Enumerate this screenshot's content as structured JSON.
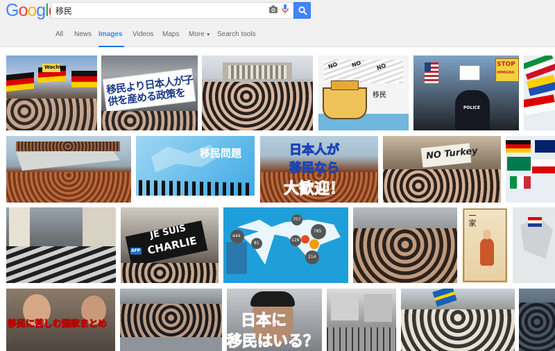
{
  "logo": {
    "letters": [
      "G",
      "o",
      "o",
      "g",
      "l",
      "e"
    ]
  },
  "search": {
    "query": "移民",
    "placeholder": ""
  },
  "tabs": [
    {
      "label": "All"
    },
    {
      "label": "News"
    },
    {
      "label": "Images"
    },
    {
      "label": "Videos"
    },
    {
      "label": "Maps"
    },
    {
      "label": "More"
    },
    {
      "label": "Search tools"
    }
  ],
  "images": {
    "r1c2_sign": "移民より日本人が子供を産める政策を",
    "r1c4_caption": "移民",
    "r1c4_no": "NO",
    "r1c5_police": "POLICE",
    "r1c5_sign": "STOP",
    "r1c5_sign2": "IMMIGRA",
    "r1c1_sign": "Wacht",
    "r2c2_title": "移民問題",
    "r2c3_line1": "日本人が",
    "r2c3_line2": "移民なら",
    "r2c3_line3": "大歓迎！",
    "r2c4_sign": "NO Turkey",
    "r3c2_line1": "JE SUIS",
    "r3c2_line2": "CHARLIE",
    "r3c2_badge": "AFP",
    "r3c3_nums": [
      "707",
      "785",
      "444",
      "81",
      "129",
      "214"
    ],
    "r3c5_text": "一家",
    "r4c1_caption": "移民に苦しむ国家まとめ",
    "r4c3_line1": "日本に",
    "r4c3_line2": "移民はいる？"
  },
  "colors": {
    "accent": "#4285f4",
    "tab_text": "#666666",
    "header_bg": "#f1f1f1"
  }
}
